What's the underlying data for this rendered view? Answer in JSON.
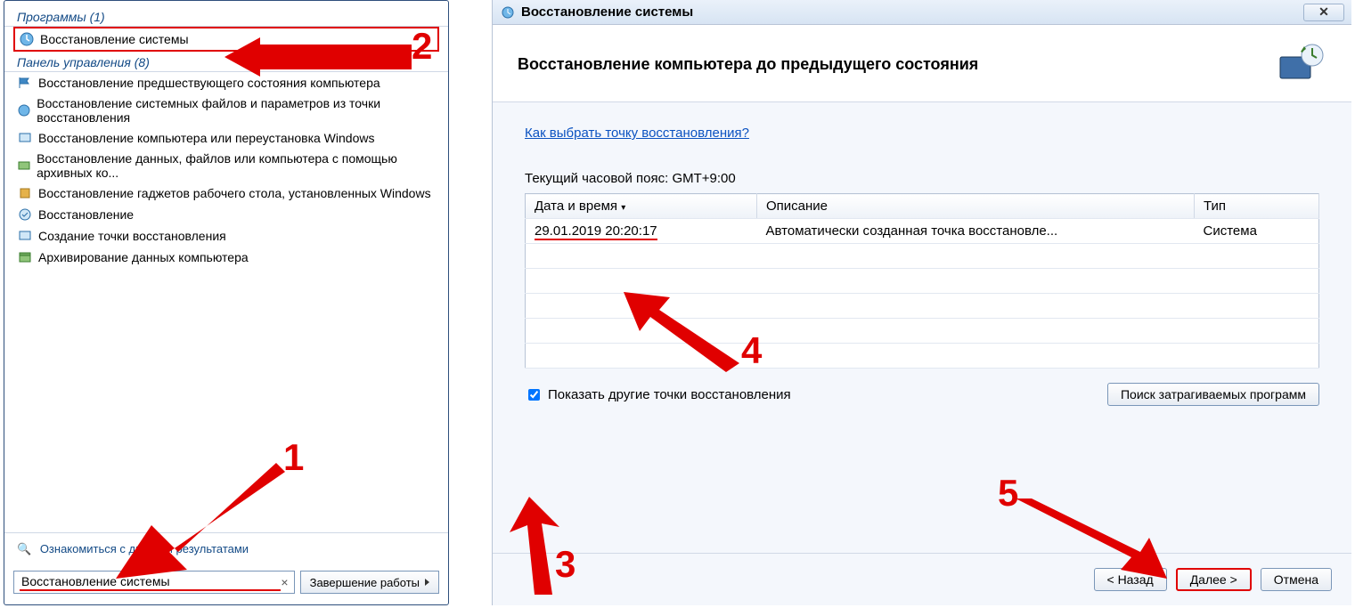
{
  "start_menu": {
    "programs_header": "Программы (1)",
    "programs": [
      {
        "label": "Восстановление системы"
      }
    ],
    "cp_header": "Панель управления (8)",
    "cp_items": [
      "Восстановление предшествующего состояния компьютера",
      "Восстановление системных файлов и параметров из точки восстановления",
      "Восстановление компьютера или переустановка Windows",
      "Восстановление данных, файлов или компьютера с помощью архивных ко...",
      "Восстановление гаджетов рабочего стола, установленных Windows",
      "Восстановление",
      "Создание точки восстановления",
      "Архивирование данных компьютера"
    ],
    "more_results": "Ознакомиться с другими результатами",
    "search_value": "Восстановление системы",
    "search_clear": "×",
    "shutdown": "Завершение работы"
  },
  "wizard": {
    "title": "Восстановление системы",
    "close_glyph": "✕",
    "heading": "Восстановление компьютера до предыдущего состояния",
    "help_link": "Как выбрать точку восстановления?",
    "timezone": "Текущий часовой пояс: GMT+9:00",
    "columns": {
      "date": "Дата и время",
      "desc": "Описание",
      "type": "Тип"
    },
    "rows": [
      {
        "date": "29.01.2019 20:20:17",
        "desc": "Автоматически созданная точка восстановле...",
        "type": "Система"
      }
    ],
    "show_more": "Показать другие точки восстановления",
    "affected_btn": "Поиск затрагиваемых программ",
    "back": "< Назад",
    "next": "Далее >",
    "cancel": "Отмена"
  },
  "annotations": {
    "n1": "1",
    "n2": "2",
    "n3": "3",
    "n4": "4",
    "n5": "5"
  }
}
